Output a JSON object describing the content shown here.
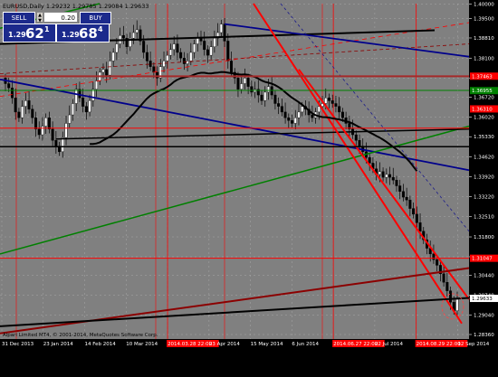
{
  "title": "EURUSD,Daily  1.29232 1.29785 1.29084 1.29633",
  "trade_panel": {
    "sell_label": "SELL",
    "buy_label": "BUY",
    "lot": "0.20",
    "sell_price_small": "1.29",
    "sell_price_big": "62",
    "sell_price_sup": "1",
    "buy_price_small": "1.29",
    "buy_price_big": "68",
    "buy_price_sup": "4"
  },
  "copyright": "Alpari Limited MT4, © 2001-2014, MetaQuotes Software Corp.",
  "colors": {
    "background": "#808080",
    "grid": "#a8a8a8",
    "axis_bg": "#000000",
    "red": "#ff0000",
    "blue": "#00008b",
    "green": "#008000",
    "black": "#000000",
    "brown": "#a52a2a",
    "dark_red": "#8b0000",
    "bull_candle": "#ffffff",
    "bear_candle": "#000000",
    "price_tag_bg": "#ff0000"
  },
  "chart_data": {
    "type": "candlestick",
    "symbol": "EURUSD",
    "timeframe": "Daily",
    "ylim": [
      1.2836,
      1.4002
    ],
    "y_ticks": [
      "1.40000",
      "1.39500",
      "1.38810",
      "1.38100",
      "1.37400",
      "1.36720",
      "1.36020",
      "1.35330",
      "1.34620",
      "1.33920",
      "1.33220",
      "1.32510",
      "1.31800",
      "1.31100",
      "1.30440",
      "1.29740",
      "1.29040",
      "1.28360"
    ],
    "x_ticks": [
      "31 Dec 2013",
      "23 Jan 2014",
      "14 Feb 2014",
      "10 Mar 2014",
      "2014.03.28 22:00",
      "23 Apr 2014",
      "15 May 2014",
      "6 Jun 2014",
      "2014.06.27 22:00",
      "22 Jul 2014",
      "2014.08.29 22:00",
      "12 Sep 2014"
    ],
    "highlighted_x_ticks": [
      "2014.03.28 22:00",
      "2014.06.27 22:00",
      "2014.08.29 22:00"
    ],
    "price_tags": [
      {
        "value": "1.37463",
        "style": "red"
      },
      {
        "value": "1.36955",
        "style": "green"
      },
      {
        "value": "1.36310",
        "style": "red"
      },
      {
        "value": "1.31047",
        "style": "red"
      },
      {
        "value": "1.29633",
        "style": "current"
      }
    ],
    "horizontal_lines": [
      {
        "price": 1.3746,
        "color": "brown",
        "width": 2
      },
      {
        "price": 1.3696,
        "color": "green",
        "width": 1
      },
      {
        "price": 1.3563,
        "color": "red",
        "width": 1
      },
      {
        "price": 1.3105,
        "color": "red",
        "width": 1
      },
      {
        "price": 1.3498,
        "color": "black",
        "width": 1.5
      }
    ],
    "closes": [
      1.372,
      1.3705,
      1.367,
      1.362,
      1.36,
      1.364,
      1.366,
      1.363,
      1.36,
      1.356,
      1.354,
      1.357,
      1.36,
      1.356,
      1.352,
      1.35,
      1.348,
      1.353,
      1.358,
      1.361,
      1.365,
      1.37,
      1.367,
      1.364,
      1.362,
      1.366,
      1.37,
      1.373,
      1.376,
      1.377,
      1.375,
      1.38,
      1.383,
      1.386,
      1.389,
      1.388,
      1.385,
      1.388,
      1.39,
      1.391,
      1.387,
      1.383,
      1.38,
      1.378,
      1.376,
      1.374,
      1.378,
      1.38,
      1.382,
      1.384,
      1.386,
      1.383,
      1.381,
      1.379,
      1.38,
      1.383,
      1.386,
      1.388,
      1.387,
      1.384,
      1.382,
      1.385,
      1.388,
      1.39,
      1.393,
      1.387,
      1.38,
      1.376,
      1.374,
      1.37,
      1.372,
      1.374,
      1.371,
      1.369,
      1.37,
      1.368,
      1.366,
      1.369,
      1.371,
      1.368,
      1.365,
      1.364,
      1.362,
      1.36,
      1.359,
      1.358,
      1.36,
      1.362,
      1.364,
      1.363,
      1.361,
      1.36,
      1.362,
      1.364,
      1.365,
      1.367,
      1.366,
      1.365,
      1.364,
      1.362,
      1.36,
      1.358,
      1.356,
      1.354,
      1.352,
      1.35,
      1.348,
      1.346,
      1.344,
      1.342,
      1.34,
      1.341,
      1.339,
      1.34,
      1.339,
      1.338,
      1.336,
      1.334,
      1.332,
      1.331,
      1.328,
      1.326,
      1.323,
      1.32,
      1.317,
      1.314,
      1.312,
      1.31,
      1.308,
      1.305,
      1.302,
      1.299,
      1.295,
      1.292,
      1.296
    ]
  }
}
